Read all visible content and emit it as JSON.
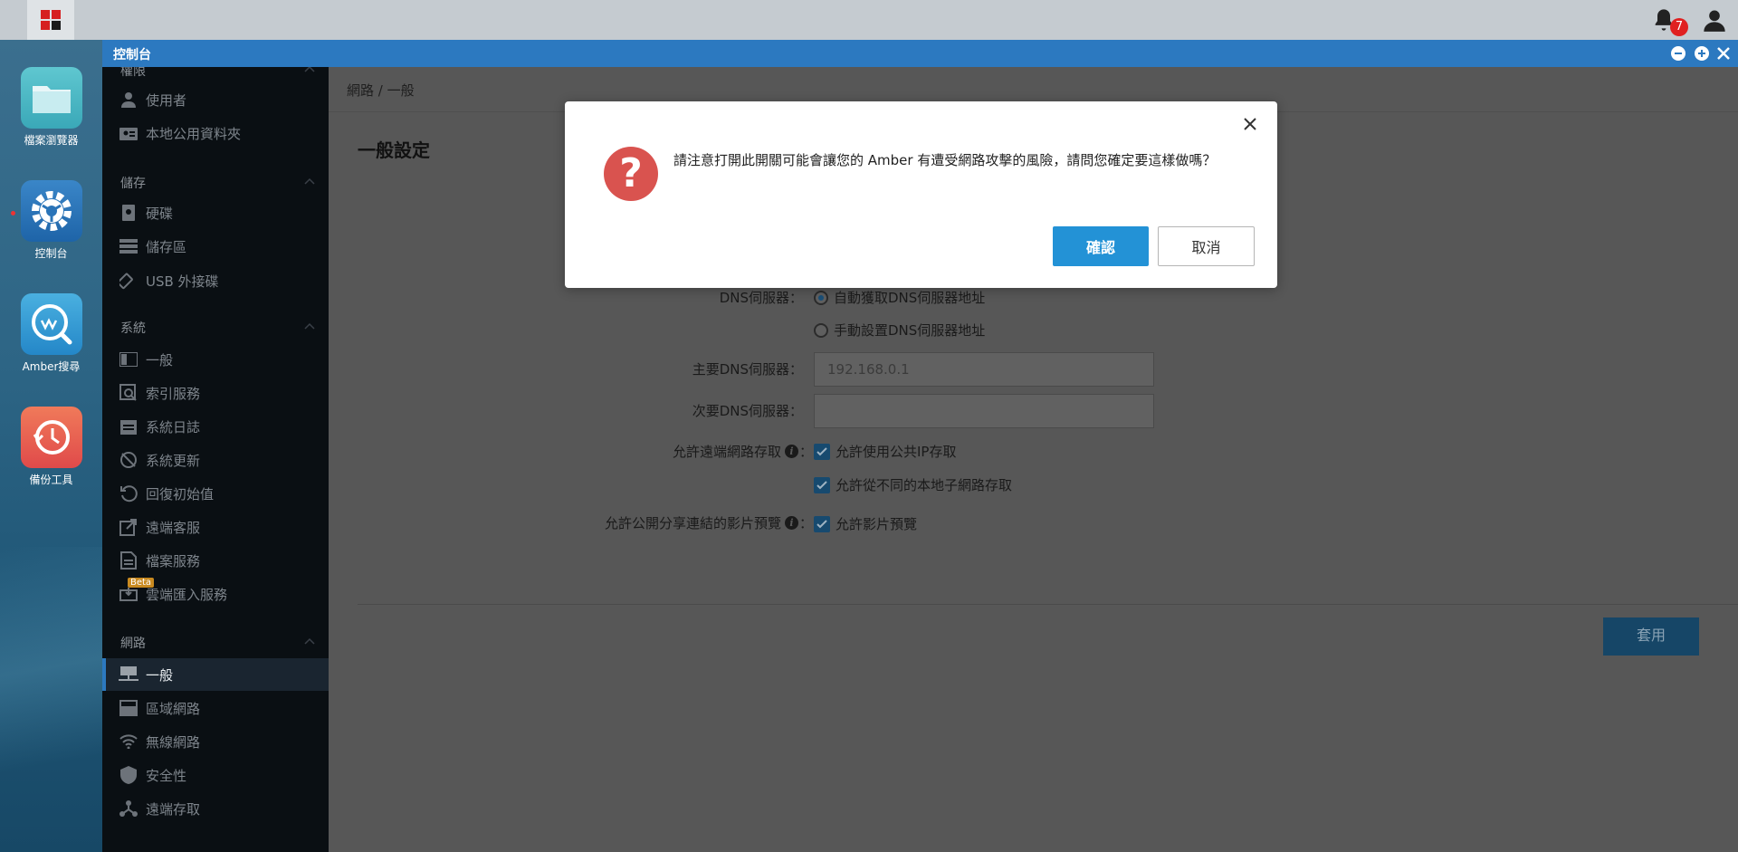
{
  "window": {
    "title": "控制台"
  },
  "desktop": {
    "icons": [
      {
        "label": "檔案瀏覽器"
      },
      {
        "label": "控制台"
      },
      {
        "label": "Amber搜尋"
      },
      {
        "label": "備份工具"
      }
    ]
  },
  "taskbar": {
    "notification_count": "7"
  },
  "sidebar": {
    "partial_section": "權限",
    "items_permission": [
      "使用者",
      "本地公用資料夾"
    ],
    "section_storage": "儲存",
    "items_storage": [
      "硬碟",
      "儲存區",
      "USB 外接碟"
    ],
    "section_system": "系統",
    "items_system": [
      "一般",
      "索引服務",
      "系統日誌",
      "系統更新",
      "回復初始值",
      "遠端客服",
      "檔案服務",
      "雲端匯入服務"
    ],
    "beta_label": "Beta",
    "section_network": "網路",
    "items_network": [
      "一般",
      "區域網路",
      "無線網路",
      "安全性",
      "遠端存取"
    ]
  },
  "content": {
    "breadcrumb": "網路 / 一般",
    "page_title": "一般設定",
    "dns_label": "DNS伺服器：",
    "dns_auto": "自動獲取DNS伺服器地址",
    "dns_manual": "手動設置DNS伺服器地址",
    "primary_dns_label": "主要DNS伺服器：",
    "primary_dns_value": "192.168.0.1",
    "secondary_dns_label": "次要DNS伺服器：",
    "secondary_dns_value": "",
    "remote_access_label": "允許遠端網路存取",
    "remote_public_ip": "允許使用公共IP存取",
    "remote_subnet": "允許從不同的本地子網路存取",
    "video_preview_label": "允許公開分享連結的影片預覽",
    "video_preview_opt": "允許影片預覽",
    "colon": "：",
    "apply_label": "套用"
  },
  "modal": {
    "message": "請注意打開此開關可能會讓您的 Amber 有遭受網路攻擊的風險，請問您確定要這樣做嗎？",
    "confirm_label": "確認",
    "cancel_label": "取消"
  }
}
